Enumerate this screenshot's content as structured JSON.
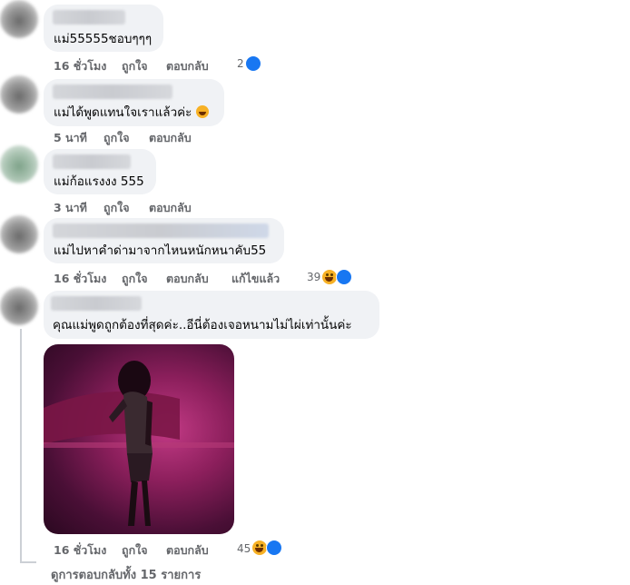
{
  "comments": [
    {
      "text": "แม่55555ชอบๆๆๆ",
      "time": "16 ชั่วโมง",
      "like": "ถูกใจ",
      "reply": "ตอบกลับ",
      "reaction_count": "2"
    },
    {
      "text": "แม่ได้พูดแทนใจเราแล้วค่ะ",
      "time": "5 นาที",
      "like": "ถูกใจ",
      "reply": "ตอบกลับ"
    },
    {
      "text": "แม่ก้อแรงงง 555",
      "time": "3 นาที",
      "like": "ถูกใจ",
      "reply": "ตอบกลับ"
    },
    {
      "text": "แม่ไปหาคำด่ามาจากไหนหนักหนาคับ55",
      "time": "16 ชั่วโมง",
      "like": "ถูกใจ",
      "reply": "ตอบกลับ",
      "edited": "แก้ไขแล้ว",
      "reaction_count": "39"
    },
    {
      "text": "คุณแม่พูดถูกต้องที่สุดค่ะ..อีนี่ต้องเจอหนามไม่ไผ่เท่านั้นค่ะ",
      "time": "16 ชั่วโมง",
      "like": "ถูกใจ",
      "reply": "ตอบกลับ",
      "reaction_count": "45"
    }
  ],
  "view_replies": "ดูการตอบกลับทั้ง 15 รายการ",
  "colors": {
    "bubble": "#f0f2f5",
    "meta": "#65676b",
    "like_blue": "#1877f2",
    "haha_yellow": "#f7b125"
  },
  "icons": {
    "like": "like-icon",
    "haha": "haha-icon",
    "reply_arrow": "reply-arrow-icon"
  }
}
